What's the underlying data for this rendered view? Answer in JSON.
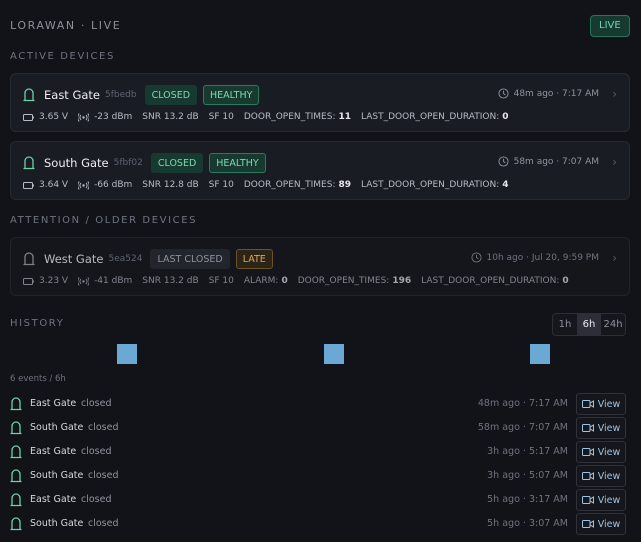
{
  "header": {
    "title": "LORAWAN · LIVE",
    "live_label": "LIVE"
  },
  "sections": {
    "active": "ACTIVE DEVICES",
    "attention": "ATTENTION / OLDER DEVICES",
    "history": "HISTORY"
  },
  "colors": {
    "accent_green": "#73d6ad",
    "warning": "#d9a85c",
    "chart_marker": "#6aa9d4"
  },
  "devices": [
    {
      "name": "East Gate",
      "id": "5fbedb",
      "state": "CLOSED",
      "health": "HEALTHY",
      "time": "48m ago · 7:17 AM",
      "voltage": "3.65 V",
      "rssi": "-23 dBm",
      "snr": "SNR 13.2 dB",
      "sf": "SF 10",
      "door_open_times_label": "DOOR_OPEN_TIMES:",
      "door_open_times": "11",
      "last_door_label": "LAST_DOOR_OPEN_DURATION:",
      "last_door": "0"
    },
    {
      "name": "South Gate",
      "id": "5fbf02",
      "state": "CLOSED",
      "health": "HEALTHY",
      "time": "58m ago · 7:07 AM",
      "voltage": "3.64 V",
      "rssi": "-66 dBm",
      "snr": "SNR 12.8 dB",
      "sf": "SF 10",
      "door_open_times_label": "DOOR_OPEN_TIMES:",
      "door_open_times": "89",
      "last_door_label": "LAST_DOOR_OPEN_DURATION:",
      "last_door": "4"
    }
  ],
  "older_devices": [
    {
      "name": "West Gate",
      "id": "5ea524",
      "state": "LAST CLOSED",
      "health": "LATE",
      "time": "10h ago · Jul 20, 9:59 PM",
      "voltage": "3.23 V",
      "rssi": "-41 dBm",
      "snr": "SNR 13.2 dB",
      "sf": "SF 10",
      "alarm_label": "ALARM:",
      "alarm": "0",
      "door_open_times_label": "DOOR_OPEN_TIMES:",
      "door_open_times": "196",
      "last_door_label": "LAST_DOOR_OPEN_DURATION:",
      "last_door": "0"
    }
  ],
  "history": {
    "ranges": [
      "1h",
      "6h",
      "24h"
    ],
    "selected_range": "6h",
    "events_count": "6 events / 6h",
    "view_label": "View",
    "events": [
      {
        "device": "East Gate",
        "state": "closed",
        "time": "48m ago · 7:17 AM"
      },
      {
        "device": "South Gate",
        "state": "closed",
        "time": "58m ago · 7:07 AM"
      },
      {
        "device": "East Gate",
        "state": "closed",
        "time": "3h ago · 5:17 AM"
      },
      {
        "device": "South Gate",
        "state": "closed",
        "time": "3h ago · 5:07 AM"
      },
      {
        "device": "East Gate",
        "state": "closed",
        "time": "5h ago · 3:17 AM"
      },
      {
        "device": "South Gate",
        "state": "closed",
        "time": "5h ago · 3:07 AM"
      }
    ]
  }
}
